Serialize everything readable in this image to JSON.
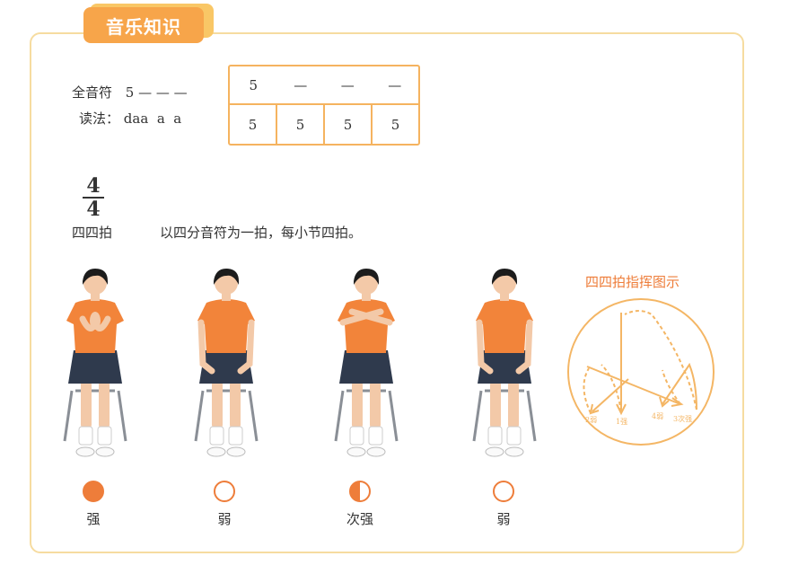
{
  "header": {
    "title": "音乐知识"
  },
  "whole_note": {
    "label": "全音符",
    "notation": "5 — — —",
    "reading_label": "读法：",
    "reading": "daa  a  a"
  },
  "note_table": {
    "top_row": [
      "5",
      "—",
      "—",
      "—"
    ],
    "bottom_row": [
      "5",
      "5",
      "5",
      "5"
    ]
  },
  "time_signature": {
    "numerator": "4",
    "denominator": "4",
    "name": "四四拍",
    "description": "以四分音符为一拍，每小节四拍。"
  },
  "beats": [
    {
      "label": "强",
      "fill": "full"
    },
    {
      "label": "弱",
      "fill": "empty"
    },
    {
      "label": "次强",
      "fill": "half"
    },
    {
      "label": "弱",
      "fill": "empty"
    }
  ],
  "conducting": {
    "title": "四四拍指挥图示",
    "labels": [
      "2弱",
      "1强",
      "4弱",
      "3次强"
    ]
  },
  "colors": {
    "accent": "#ee7d3a",
    "tab": "#f7a54a",
    "border": "#f5b35f",
    "shirt": "#f2843a",
    "skirt": "#2f3a4d",
    "diagram": "#f4b665"
  }
}
